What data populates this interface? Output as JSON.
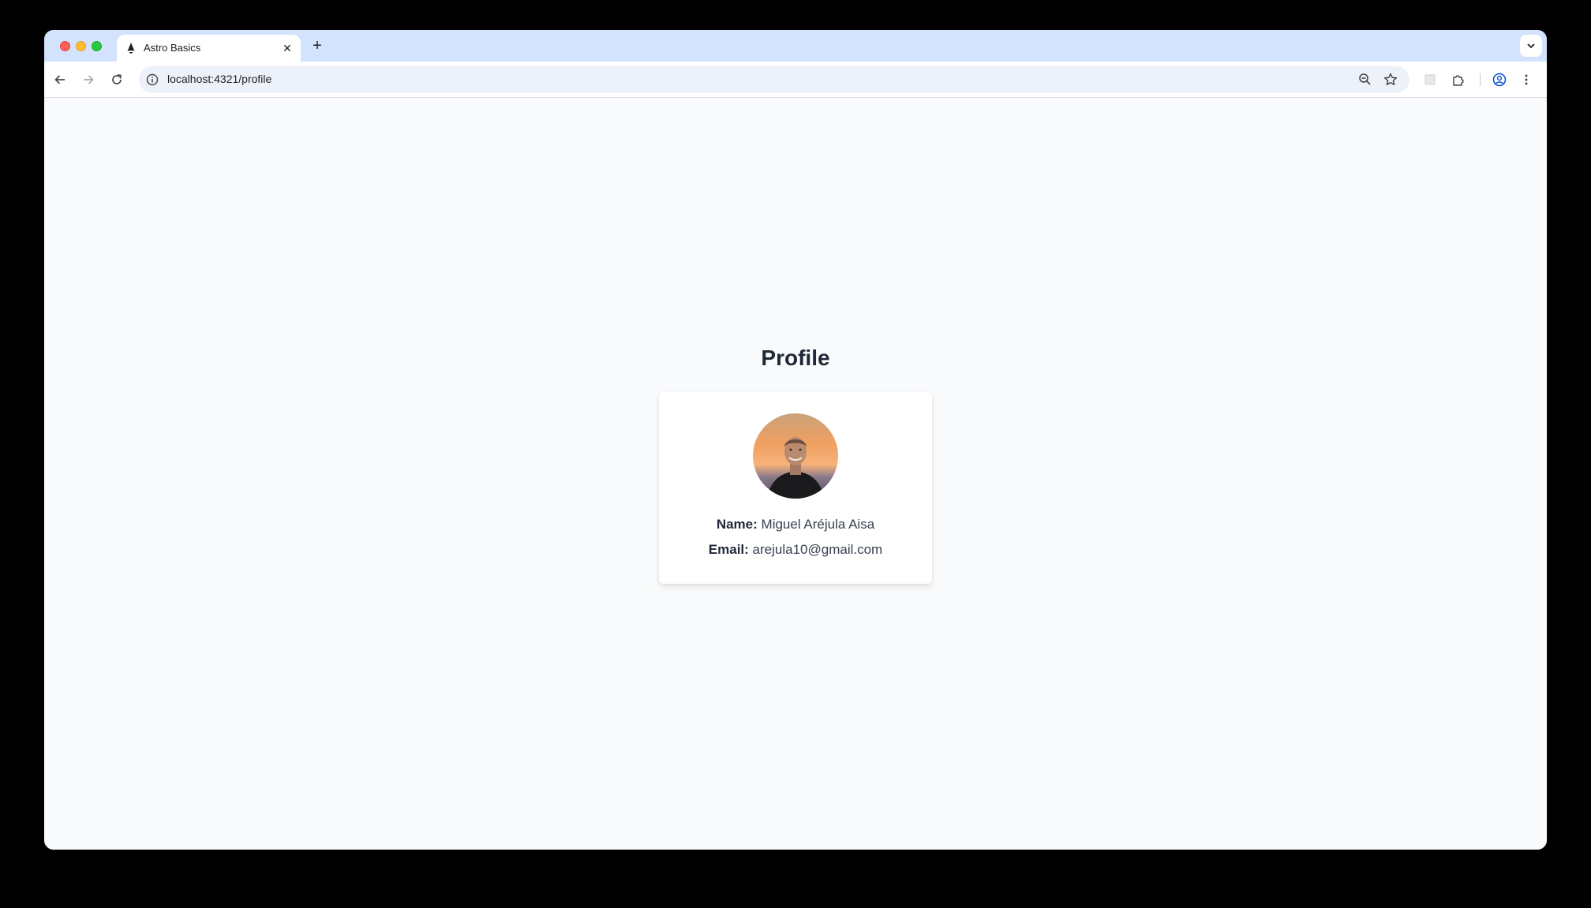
{
  "browser": {
    "tab": {
      "title": "Astro Basics",
      "favicon": "astro-logo-icon",
      "close_icon": "close-icon"
    },
    "new_tab_icon": "plus-icon",
    "tab_list_icon": "chevron-down-icon",
    "toolbar": {
      "back_icon": "arrow-left-icon",
      "forward_icon": "arrow-right-icon",
      "reload_icon": "reload-icon",
      "url": "localhost:4321/profile",
      "site_info_icon": "info-icon",
      "zoom_icon": "zoom-out-icon",
      "bookmark_icon": "star-icon",
      "extensions": [
        "extension-placeholder-icon",
        "puzzle-icon"
      ],
      "profile_icon": "account-circle-icon",
      "menu_icon": "more-vert-icon"
    },
    "colors": {
      "tabstrip": "#d3e3fd",
      "omnibox": "#edf2fa",
      "page_background": "#f9fafb",
      "accent": "#0b57d0"
    }
  },
  "page": {
    "title": "Profile",
    "card": {
      "avatar_icon": "profile-photo",
      "name_label": "Name:",
      "name_value": "Miguel Aréjula Aisa",
      "email_label": "Email:",
      "email_value": "arejula10@gmail.com"
    }
  }
}
